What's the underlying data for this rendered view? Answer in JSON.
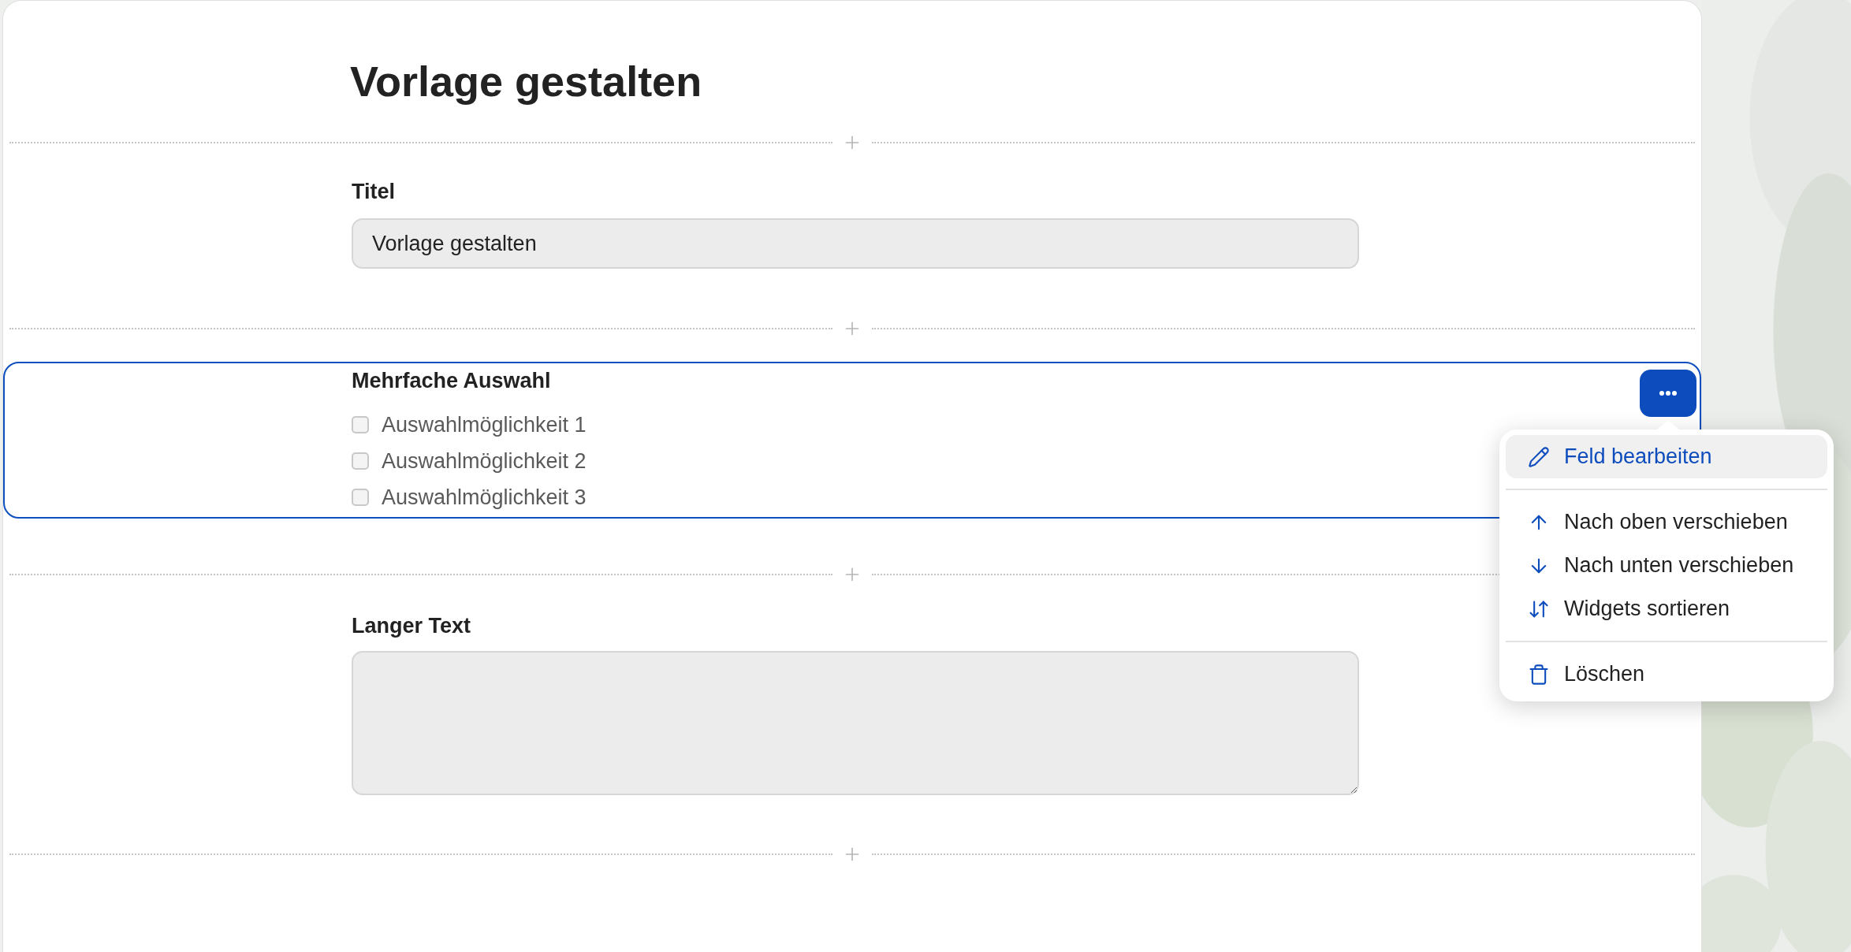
{
  "page": {
    "title": "Vorlage gestalten"
  },
  "fields": [
    {
      "kind": "text",
      "label": "Titel",
      "value": "Vorlage gestalten",
      "selected": false
    },
    {
      "kind": "checkboxes",
      "label": "Mehrfache Auswahl",
      "selected": true,
      "options": [
        {
          "label": "Auswahlmöglichkeit 1",
          "checked": false
        },
        {
          "label": "Auswahlmöglichkeit 2",
          "checked": false
        },
        {
          "label": "Auswahlmöglichkeit 3",
          "checked": false
        }
      ]
    },
    {
      "kind": "textarea",
      "label": "Langer Text",
      "selected": false
    }
  ],
  "menu": {
    "groups": [
      [
        {
          "kind": "edit",
          "label": "Feld bearbeiten",
          "selected": true
        }
      ],
      [
        {
          "kind": "up",
          "label": "Nach oben verschieben",
          "selected": false
        },
        {
          "kind": "down",
          "label": "Nach unten verschieben",
          "selected": false
        },
        {
          "kind": "sort",
          "label": "Widgets sortieren",
          "selected": false
        }
      ],
      [
        {
          "kind": "delete",
          "label": "Löschen",
          "selected": false
        }
      ]
    ]
  }
}
